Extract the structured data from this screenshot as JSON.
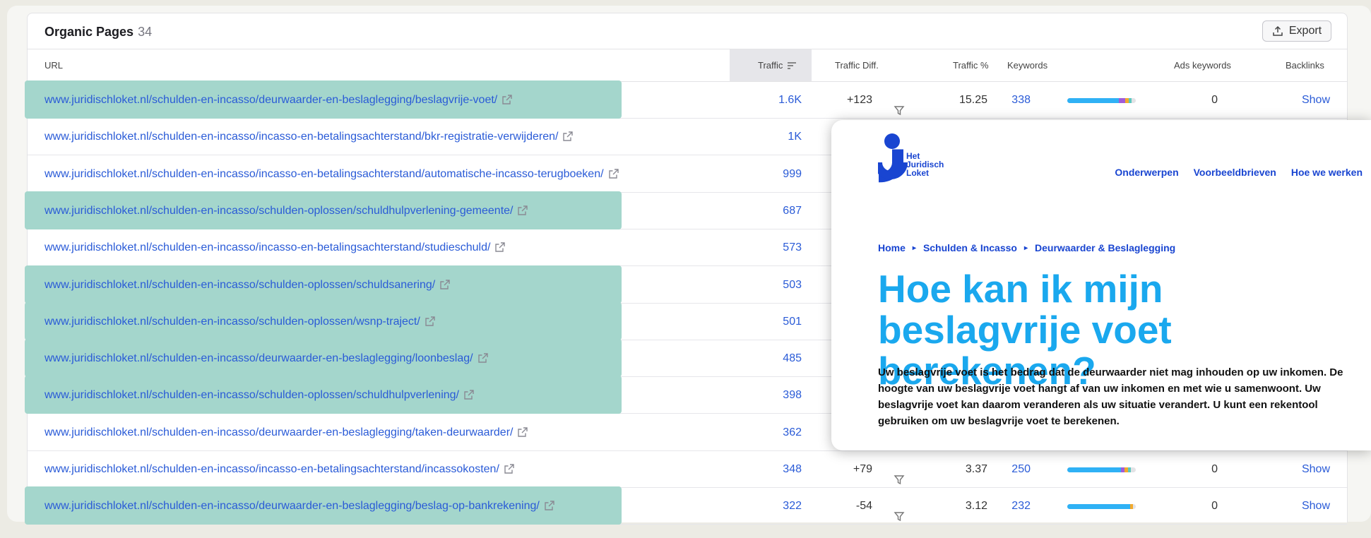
{
  "panel": {
    "title": "Organic Pages",
    "count": "34",
    "export_label": "Export"
  },
  "columns": {
    "url": "URL",
    "traffic": "Traffic",
    "traffic_diff": "Traffic Diff.",
    "traffic_pct": "Traffic %",
    "keywords": "Keywords",
    "ads_keywords": "Ads keywords",
    "backlinks": "Backlinks"
  },
  "rows": [
    {
      "url": "www.juridischloket.nl/schulden-en-incasso/deurwaarder-en-beslaglegging/beslagvrije-voet/",
      "traffic": "1.6K",
      "diff": "+123",
      "pct": "15.25",
      "keywords": "338",
      "ads": "0",
      "backlinks": "Show",
      "highlighted": true
    },
    {
      "url": "www.juridischloket.nl/schulden-en-incasso/incasso-en-betalingsachterstand/bkr-registratie-verwijderen/",
      "traffic": "1K",
      "highlighted": false
    },
    {
      "url": "www.juridischloket.nl/schulden-en-incasso/incasso-en-betalingsachterstand/automatische-incasso-terugboeken/",
      "traffic": "999",
      "highlighted": false
    },
    {
      "url": "www.juridischloket.nl/schulden-en-incasso/schulden-oplossen/schuldhulpverlening-gemeente/",
      "traffic": "687",
      "highlighted": true
    },
    {
      "url": "www.juridischloket.nl/schulden-en-incasso/incasso-en-betalingsachterstand/studieschuld/",
      "traffic": "573",
      "highlighted": false
    },
    {
      "url": "www.juridischloket.nl/schulden-en-incasso/schulden-oplossen/schuldsanering/",
      "traffic": "503",
      "highlighted": true
    },
    {
      "url": "www.juridischloket.nl/schulden-en-incasso/schulden-oplossen/wsnp-traject/",
      "traffic": "501",
      "highlighted": true
    },
    {
      "url": "www.juridischloket.nl/schulden-en-incasso/deurwaarder-en-beslaglegging/loonbeslag/",
      "traffic": "485",
      "highlighted": true
    },
    {
      "url": "www.juridischloket.nl/schulden-en-incasso/schulden-oplossen/schuldhulpverlening/",
      "traffic": "398",
      "highlighted": true
    },
    {
      "url": "www.juridischloket.nl/schulden-en-incasso/deurwaarder-en-beslaglegging/taken-deurwaarder/",
      "traffic": "362",
      "highlighted": false
    },
    {
      "url": "www.juridischloket.nl/schulden-en-incasso/incasso-en-betalingsachterstand/incassokosten/",
      "traffic": "348",
      "diff": "+79",
      "pct": "3.37",
      "keywords": "250",
      "ads": "0",
      "backlinks": "Show",
      "highlighted": false
    },
    {
      "url": "www.juridischloket.nl/schulden-en-incasso/deurwaarder-en-beslaglegging/beslag-op-bankrekening/",
      "traffic": "322",
      "diff": "-54",
      "pct": "3.12",
      "keywords": "232",
      "ads": "0",
      "backlinks": "Show",
      "highlighted": true
    }
  ],
  "preview": {
    "logo_text": [
      "Het",
      "Juridisch",
      "Loket"
    ],
    "nav": [
      "Onderwerpen",
      "Voorbeeldbrieven",
      "Hoe we werken"
    ],
    "breadcrumb": [
      "Home",
      "Schulden & Incasso",
      "Deurwaarder & Beslaglegging"
    ],
    "headline": "Hoe kan ik mijn beslagvrije voet berekenen?",
    "intro": "Uw beslagvrije voet is het bedrag dat de deurwaarder niet mag inhouden op uw inkomen. De hoogte van uw beslagvrije voet hangt af van uw inkomen en met wie u samenwoont. Uw beslagvrije voet kan daarom veranderen als uw situatie verandert. U kunt een rekentool gebruiken om uw beslagvrije voet te berekenen."
  },
  "colors": {
    "link": "#2a5bd7",
    "highlight": "#a4d6cc",
    "headline": "#1aa8ee",
    "brand_blue": "#1945d1"
  }
}
